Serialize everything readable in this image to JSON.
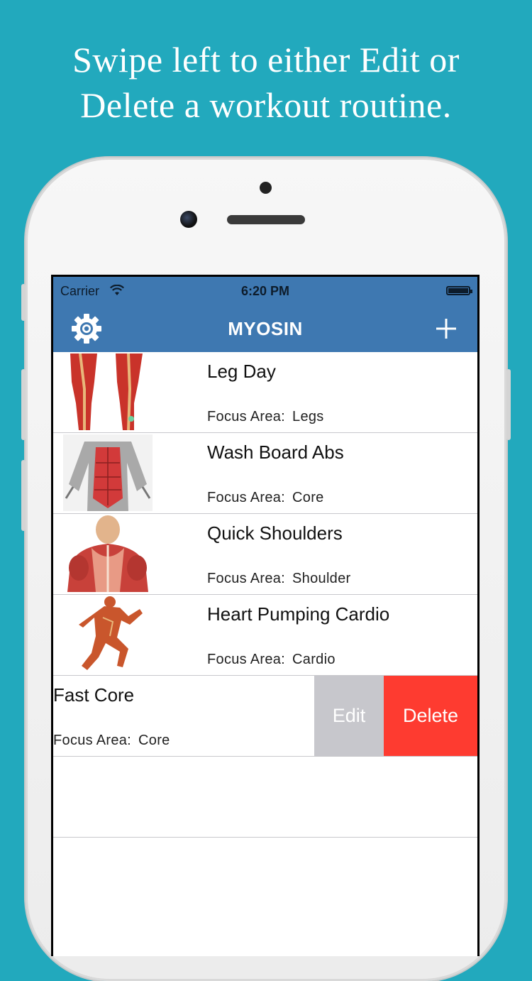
{
  "headline": {
    "line1": "Swipe left to either Edit or",
    "line2": "Delete a workout routine."
  },
  "status_bar": {
    "carrier": "Carrier",
    "time": "6:20 PM",
    "wifi_icon": "wifi-icon",
    "battery_icon": "battery-icon"
  },
  "nav": {
    "title": "MYOSIN",
    "settings_icon": "gear-icon",
    "add_icon": "plus-icon"
  },
  "routines": [
    {
      "name": "Leg Day",
      "focus_label": "Focus Area:",
      "focus_value": "Legs",
      "thumb_icon": "legs-muscle-image"
    },
    {
      "name": "Wash Board Abs",
      "focus_label": "Focus Area:",
      "focus_value": "Core",
      "thumb_icon": "abs-muscle-image"
    },
    {
      "name": "Quick Shoulders",
      "focus_label": "Focus Area:",
      "focus_value": "Shoulder",
      "thumb_icon": "shoulder-muscle-image"
    },
    {
      "name": "Heart Pumping Cardio",
      "focus_label": "Focus Area:",
      "focus_value": "Cardio",
      "thumb_icon": "runner-muscle-image"
    }
  ],
  "swiped_row": {
    "name": "Fast Core",
    "focus_label": "Focus Area:",
    "focus_value": "Core",
    "edit_label": "Edit",
    "delete_label": "Delete"
  },
  "colors": {
    "background": "#22a9bd",
    "nav_bar": "#3e78b1",
    "edit_action": "#c7c7cc",
    "delete_action": "#fe3b30"
  }
}
